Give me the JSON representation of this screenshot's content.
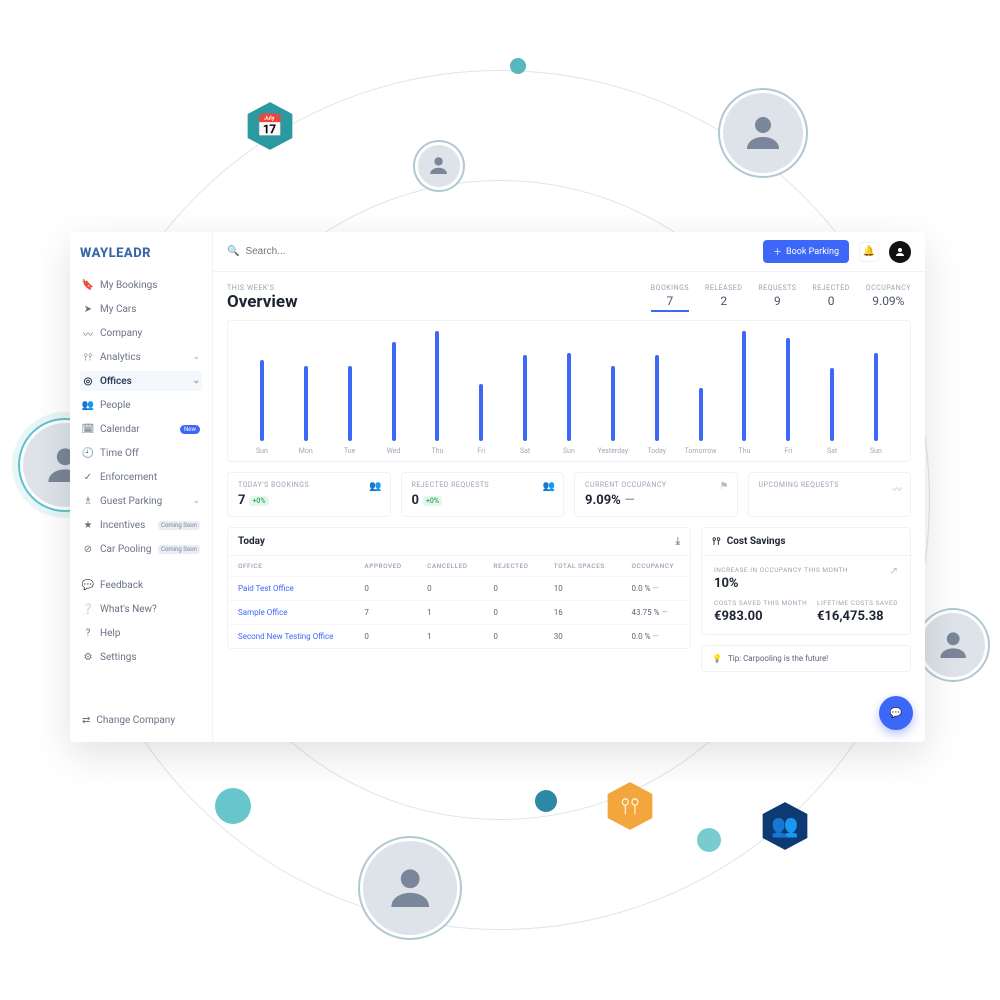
{
  "brand": "WAYLEADR",
  "search": {
    "placeholder": "Search..."
  },
  "actions": {
    "book": "Book Parking"
  },
  "nav": {
    "items": [
      {
        "label": "My Bookings"
      },
      {
        "label": "My Cars"
      },
      {
        "label": "Company"
      },
      {
        "label": "Analytics"
      },
      {
        "label": "Offices"
      },
      {
        "label": "People"
      },
      {
        "label": "Calendar",
        "badge": "New"
      },
      {
        "label": "Time Off"
      },
      {
        "label": "Enforcement"
      },
      {
        "label": "Guest Parking"
      },
      {
        "label": "Incentives",
        "badge": "Coming Soon"
      },
      {
        "label": "Car Pooling",
        "badge": "Coming Soon"
      }
    ],
    "lower": [
      {
        "label": "Feedback"
      },
      {
        "label": "What's New?"
      },
      {
        "label": "Help"
      },
      {
        "label": "Settings"
      }
    ],
    "change": "Change Company"
  },
  "overview": {
    "suptitle": "THIS WEEK'S",
    "title": "Overview",
    "stats": [
      {
        "label": "BOOKINGS",
        "value": "7"
      },
      {
        "label": "RELEASED",
        "value": "2"
      },
      {
        "label": "REQUESTS",
        "value": "9"
      },
      {
        "label": "REJECTED",
        "value": "0"
      },
      {
        "label": "OCCUPANCY",
        "value": "9.09%"
      }
    ]
  },
  "kpi": {
    "bookings": {
      "label": "TODAY'S BOOKINGS",
      "value": "7",
      "delta": "+0%"
    },
    "rejected": {
      "label": "REJECTED REQUESTS",
      "value": "0",
      "delta": "+0%"
    },
    "occupancy": {
      "label": "CURRENT OCCUPANCY",
      "value": "9.09%",
      "trend": "—"
    },
    "upcoming": {
      "label": "UPCOMING REQUESTS",
      "value": ""
    }
  },
  "today": {
    "title": "Today",
    "headers": [
      "OFFICE",
      "APPROVED",
      "CANCELLED",
      "REJECTED",
      "TOTAL SPACES",
      "OCCUPANCY"
    ],
    "rows": [
      {
        "office": "Paid Test Office",
        "approved": "0",
        "cancelled": "0",
        "rejected": "0",
        "spaces": "10",
        "occ": "0.0 %"
      },
      {
        "office": "Sample Office",
        "approved": "7",
        "cancelled": "1",
        "rejected": "0",
        "spaces": "16",
        "occ": "43.75 %"
      },
      {
        "office": "Second New Testing Office",
        "approved": "0",
        "cancelled": "1",
        "rejected": "0",
        "spaces": "30",
        "occ": "0.0 %"
      }
    ]
  },
  "savings": {
    "title": "Cost Savings",
    "inc_label": "INCREASE IN OCCUPANCY THIS MONTH",
    "inc_value": "10%",
    "month_label": "COSTS SAVED THIS MONTH",
    "month_value": "€983.00",
    "life_label": "LIFETIME COSTS SAVED",
    "life_value": "€16,475.38"
  },
  "tip": "Tip: Carpooling is the future!",
  "chart_data": {
    "type": "bar",
    "title": "This week's overview",
    "xlabel": "",
    "ylabel": "",
    "ylim": [
      0,
      100
    ],
    "categories": [
      "Sun",
      "Mon",
      "Tue",
      "Wed",
      "Thu",
      "Fri",
      "Sat",
      "Sun",
      "Yesterday",
      "Today",
      "Tomorrow",
      "Thu",
      "Fri",
      "Sat",
      "Sun"
    ],
    "values": [
      74,
      68,
      68,
      90,
      100,
      52,
      78,
      80,
      68,
      78,
      48,
      100,
      94,
      66,
      80
    ]
  }
}
